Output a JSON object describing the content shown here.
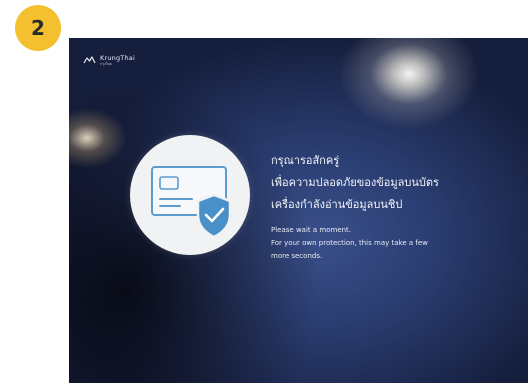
{
  "step": {
    "number": "2",
    "color": "#f4c02f"
  },
  "screen": {
    "logo": {
      "name": "KrungThai",
      "sub": "กรุงไทย"
    },
    "icon": "card-shield-icon",
    "accent_color": "#4a90c8",
    "thai_lines": [
      "กรุณารอสักครู่",
      "เพื่อความปลอดภัยของข้อมูลบนบัตร",
      "เครื่องกำลังอ่านข้อมูลบนชิป"
    ],
    "english_lines": [
      "Please wait a moment.",
      "For your own protection, this may take a few",
      "more seconds."
    ]
  }
}
